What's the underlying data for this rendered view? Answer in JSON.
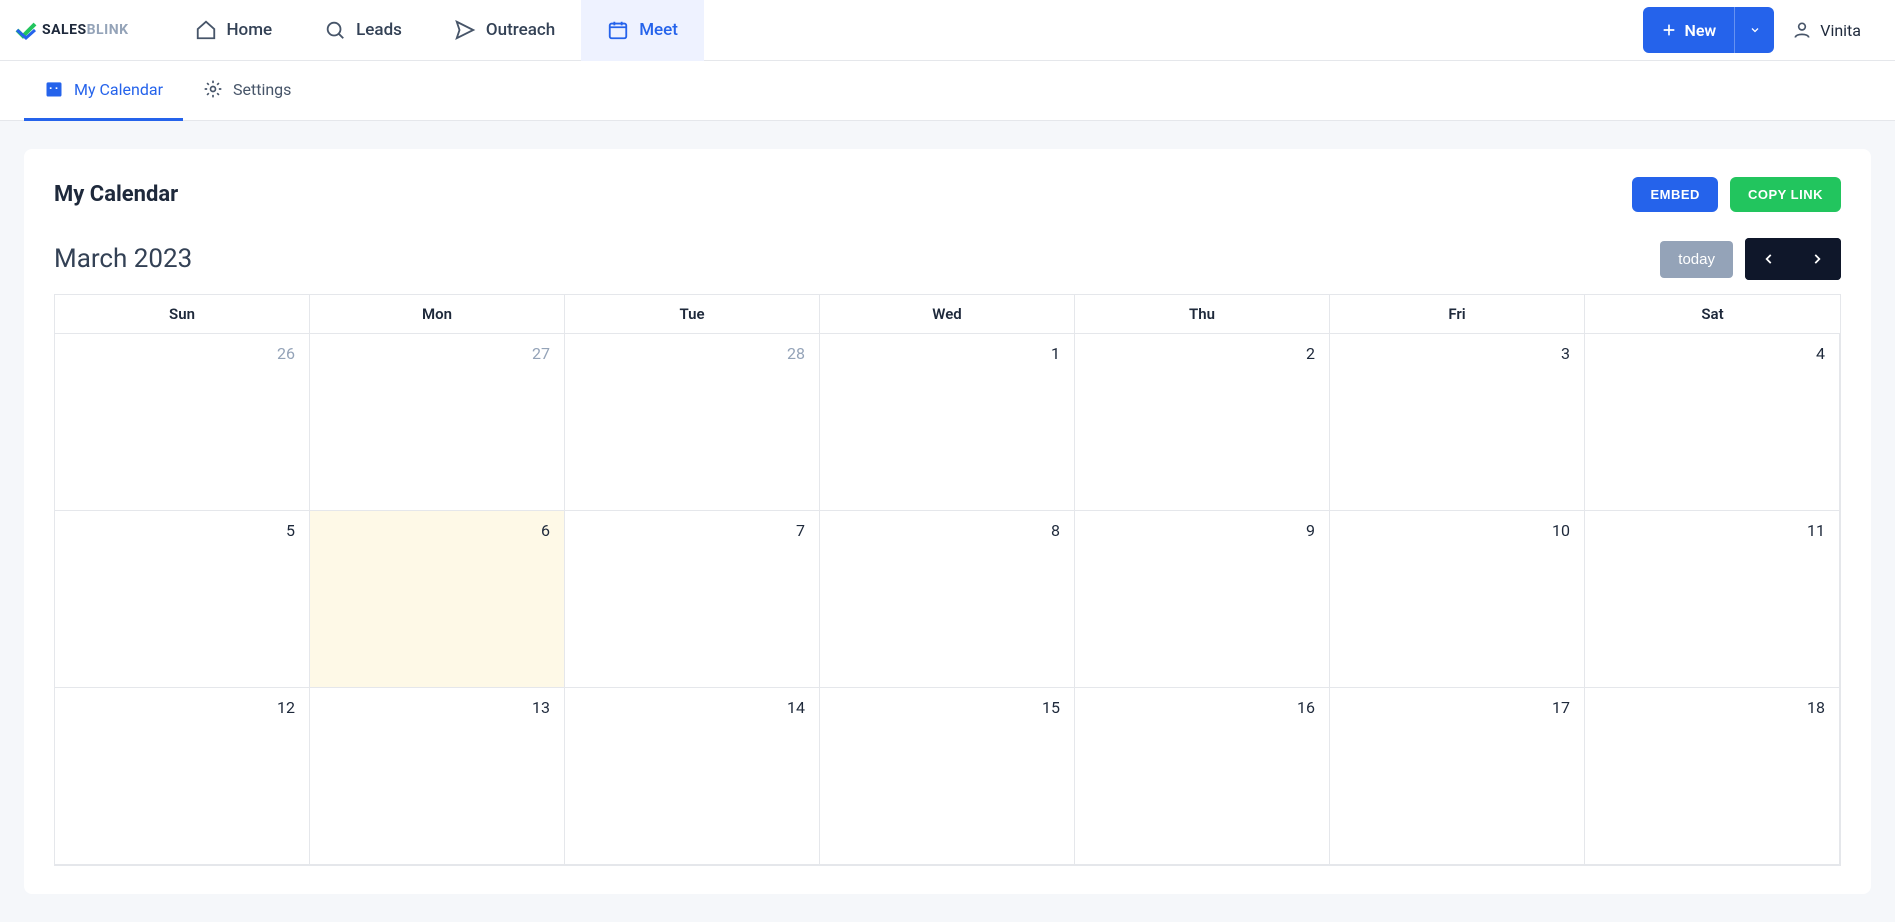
{
  "brand": {
    "name_a": "SALES",
    "name_b": "BLINK"
  },
  "top_nav": {
    "items": [
      {
        "label": "Home"
      },
      {
        "label": "Leads"
      },
      {
        "label": "Outreach"
      },
      {
        "label": "Meet"
      }
    ],
    "new_label": "New",
    "user": "Vinita"
  },
  "sub_nav": {
    "items": [
      {
        "label": "My Calendar"
      },
      {
        "label": "Settings"
      }
    ]
  },
  "page": {
    "title": "My Calendar",
    "embed_label": "EMBED",
    "copy_label": "COPY LINK",
    "month_label": "March 2023",
    "today_label": "today"
  },
  "calendar": {
    "weekdays": [
      "Sun",
      "Mon",
      "Tue",
      "Wed",
      "Thu",
      "Fri",
      "Sat"
    ],
    "cells": [
      {
        "n": "26",
        "other": true
      },
      {
        "n": "27",
        "other": true
      },
      {
        "n": "28",
        "other": true
      },
      {
        "n": "1"
      },
      {
        "n": "2"
      },
      {
        "n": "3"
      },
      {
        "n": "4"
      },
      {
        "n": "5"
      },
      {
        "n": "6",
        "today": true
      },
      {
        "n": "7"
      },
      {
        "n": "8"
      },
      {
        "n": "9"
      },
      {
        "n": "10"
      },
      {
        "n": "11"
      },
      {
        "n": "12"
      },
      {
        "n": "13"
      },
      {
        "n": "14"
      },
      {
        "n": "15"
      },
      {
        "n": "16"
      },
      {
        "n": "17"
      },
      {
        "n": "18"
      }
    ]
  }
}
